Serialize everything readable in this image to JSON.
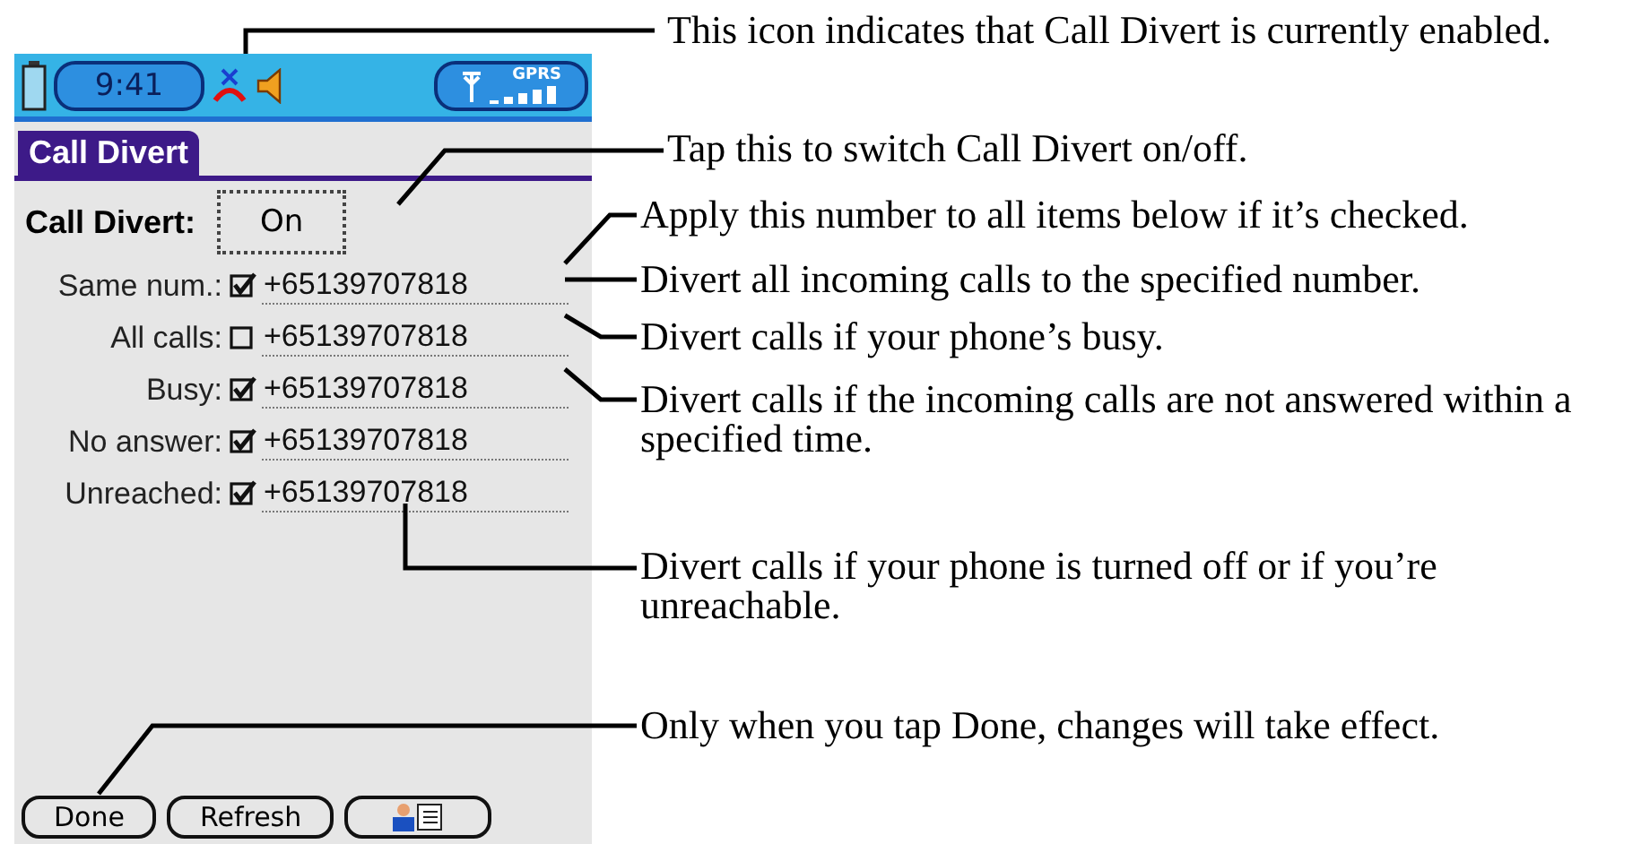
{
  "status_bar": {
    "time": "9:41",
    "network": "GPRS"
  },
  "title": "Call Divert",
  "call_divert": {
    "label": "Call Divert:",
    "value": "On"
  },
  "rows": [
    {
      "label": "Same num.:",
      "checked": true,
      "number": "+65139707818"
    },
    {
      "label": "All calls:",
      "checked": false,
      "number": "+65139707818"
    },
    {
      "label": "Busy:",
      "checked": true,
      "number": "+65139707818"
    },
    {
      "label": "No answer:",
      "checked": true,
      "number": "+65139707818"
    },
    {
      "label": "Unreached:",
      "checked": true,
      "number": "+65139707818"
    }
  ],
  "buttons": [
    {
      "kind": "text",
      "label": "Done"
    },
    {
      "kind": "text",
      "label": "Refresh"
    },
    {
      "kind": "icon"
    }
  ],
  "callouts": [
    "This icon indicates that Call Divert is currently enabled.",
    "Tap this to switch Call Divert on/off.",
    "Apply this number to all items below if it’s checked.",
    "Divert all incoming calls to the specified number.",
    "Divert calls if your phone’s busy.",
    "Divert calls if the incoming calls are not answered within a specified time.",
    "Divert calls if your phone is turned off or if you’re unreachable.",
    "Only when you tap Done, changes will take effect."
  ]
}
